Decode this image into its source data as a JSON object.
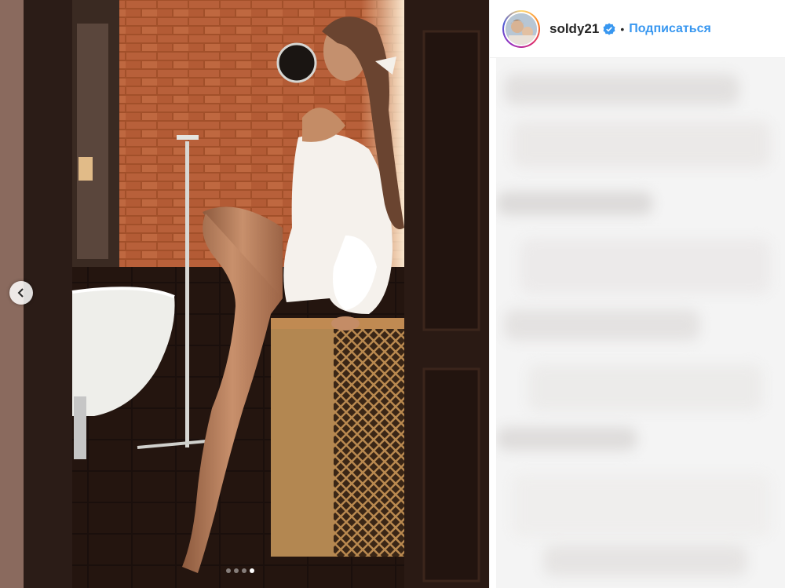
{
  "post": {
    "username": "soldy21",
    "separator": "•",
    "follow_label": "Подписаться",
    "verified": true,
    "carousel": {
      "total": 4,
      "active_index": 4
    }
  },
  "icons": {
    "prev": "chevron-left-icon",
    "verified": "verified-badge-icon"
  },
  "colors": {
    "accent": "#3897f0",
    "text": "#262626",
    "border": "#efefef"
  }
}
